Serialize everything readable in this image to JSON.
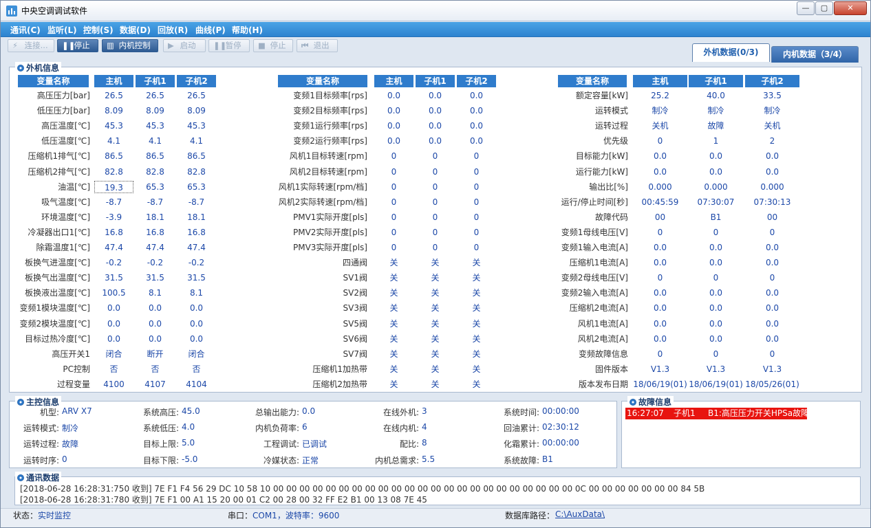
{
  "window": {
    "title": "中央空调调试软件",
    "controls": {
      "minimize": "—",
      "maximize": "▢",
      "close": "✕"
    }
  },
  "menu": [
    "通讯(C)",
    "监听(L)",
    "控制(S)",
    "数据(D)",
    "回放(R)",
    "曲线(P)",
    "帮助(H)"
  ],
  "toolbar": [
    {
      "label": "连接...",
      "icon": "connect-icon",
      "glyph": "⚡",
      "enabled": false
    },
    {
      "label": "停止",
      "icon": "pause-icon",
      "glyph": "❚❚",
      "enabled": true
    },
    {
      "label": "内机控制",
      "icon": "indoor-control-icon",
      "glyph": "▥",
      "enabled": true
    },
    {
      "label": "启动",
      "icon": "play-icon",
      "glyph": "▶",
      "enabled": false
    },
    {
      "label": "暂停",
      "icon": "pause-icon",
      "glyph": "❚❚",
      "enabled": false
    },
    {
      "label": "停止",
      "icon": "stop-icon",
      "glyph": "■",
      "enabled": false
    },
    {
      "label": "退出",
      "icon": "exit-icon",
      "glyph": "⏮",
      "enabled": false
    }
  ],
  "tabs": {
    "outdoor": "外机数据(0/3)",
    "indoor": "内机数据（3/4）"
  },
  "outdoor_panel": {
    "title": "外机信息",
    "headers": [
      "变量名称",
      "主机",
      "子机1",
      "子机2"
    ],
    "table1": [
      [
        "高压压力[bar]",
        "26.5",
        "26.5",
        "26.5"
      ],
      [
        "低压压力[bar]",
        "8.09",
        "8.09",
        "8.09"
      ],
      [
        "高压温度[℃]",
        "45.3",
        "45.3",
        "45.3"
      ],
      [
        "低压温度[℃]",
        "4.1",
        "4.1",
        "4.1"
      ],
      [
        "压缩机1排气[℃]",
        "86.5",
        "86.5",
        "86.5"
      ],
      [
        "压缩机2排气[℃]",
        "82.8",
        "82.8",
        "82.8"
      ],
      [
        "油温[℃]",
        "19.3",
        "65.3",
        "65.3"
      ],
      [
        "吸气温度[℃]",
        "-8.7",
        "-8.7",
        "-8.7"
      ],
      [
        "环境温度[℃]",
        "-3.9",
        "18.1",
        "18.1"
      ],
      [
        "冷凝器出口1[℃]",
        "16.8",
        "16.8",
        "16.8"
      ],
      [
        "除霜温度1[℃]",
        "47.4",
        "47.4",
        "47.4"
      ],
      [
        "板换气进温度[℃]",
        "-0.2",
        "-0.2",
        "-0.2"
      ],
      [
        "板换气出温度[℃]",
        "31.5",
        "31.5",
        "31.5"
      ],
      [
        "板换液出温度[℃]",
        "100.5",
        "8.1",
        "8.1"
      ],
      [
        "变频1模块温度[℃]",
        "0.0",
        "0.0",
        "0.0"
      ],
      [
        "变频2模块温度[℃]",
        "0.0",
        "0.0",
        "0.0"
      ],
      [
        "目标过热冷度[℃]",
        "0.0",
        "0.0",
        "0.0"
      ],
      [
        "高压开关1",
        "闭合",
        "断开",
        "闭合"
      ],
      [
        "PC控制",
        "否",
        "否",
        "否"
      ],
      [
        "过程变量",
        "4100",
        "4107",
        "4104"
      ]
    ],
    "table2": [
      [
        "变频1目标频率[rps]",
        "0.0",
        "0.0",
        "0.0"
      ],
      [
        "变频2目标频率[rps]",
        "0.0",
        "0.0",
        "0.0"
      ],
      [
        "变频1运行频率[rps]",
        "0.0",
        "0.0",
        "0.0"
      ],
      [
        "变频2运行频率[rps]",
        "0.0",
        "0.0",
        "0.0"
      ],
      [
        "风机1目标转速[rpm]",
        "0",
        "0",
        "0"
      ],
      [
        "风机2目标转速[rpm]",
        "0",
        "0",
        "0"
      ],
      [
        "风机1实际转速[rpm/档]",
        "0",
        "0",
        "0"
      ],
      [
        "风机2实际转速[rpm/档]",
        "0",
        "0",
        "0"
      ],
      [
        "PMV1实际开度[pls]",
        "0",
        "0",
        "0"
      ],
      [
        "PMV2实际开度[pls]",
        "0",
        "0",
        "0"
      ],
      [
        "PMV3实际开度[pls]",
        "0",
        "0",
        "0"
      ],
      [
        "四通阀",
        "关",
        "关",
        "关"
      ],
      [
        "SV1阀",
        "关",
        "关",
        "关"
      ],
      [
        "SV2阀",
        "关",
        "关",
        "关"
      ],
      [
        "SV3阀",
        "关",
        "关",
        "关"
      ],
      [
        "SV5阀",
        "关",
        "关",
        "关"
      ],
      [
        "SV6阀",
        "关",
        "关",
        "关"
      ],
      [
        "SV7阀",
        "关",
        "关",
        "关"
      ],
      [
        "压缩机1加热带",
        "关",
        "关",
        "关"
      ],
      [
        "压缩机2加热带",
        "关",
        "关",
        "关"
      ]
    ],
    "table3": [
      [
        "额定容量[kW]",
        "25.2",
        "40.0",
        "33.5"
      ],
      [
        "运转模式",
        "制冷",
        "制冷",
        "制冷"
      ],
      [
        "运转过程",
        "关机",
        "故障",
        "关机"
      ],
      [
        "优先级",
        "0",
        "1",
        "2"
      ],
      [
        "目标能力[kW]",
        "0.0",
        "0.0",
        "0.0"
      ],
      [
        "运行能力[kW]",
        "0.0",
        "0.0",
        "0.0"
      ],
      [
        "输出比[%]",
        "0.000",
        "0.000",
        "0.000"
      ],
      [
        "运行/停止时间[秒]",
        "00:45:59",
        "07:30:07",
        "07:30:13"
      ],
      [
        "故障代码",
        "00",
        "B1",
        "00"
      ],
      [
        "变频1母线电压[V]",
        "0",
        "0",
        "0"
      ],
      [
        "变频1输入电流[A]",
        "0.0",
        "0.0",
        "0.0"
      ],
      [
        "压缩机1电流[A]",
        "0.0",
        "0.0",
        "0.0"
      ],
      [
        "变频2母线电压[V]",
        "0",
        "0",
        "0"
      ],
      [
        "变频2输入电流[A]",
        "0.0",
        "0.0",
        "0.0"
      ],
      [
        "压缩机2电流[A]",
        "0.0",
        "0.0",
        "0.0"
      ],
      [
        "风机1电流[A]",
        "0.0",
        "0.0",
        "0.0"
      ],
      [
        "风机2电流[A]",
        "0.0",
        "0.0",
        "0.0"
      ],
      [
        "变频故障信息",
        "0",
        "0",
        "0"
      ],
      [
        "固件版本",
        "V1.3",
        "V1.3",
        "V1.3"
      ],
      [
        "版本发布日期",
        "18/06/19(01)",
        "18/06/19(01)",
        "18/05/26(01)"
      ]
    ]
  },
  "main_panel": {
    "title": "主控信息",
    "columns": [
      [
        [
          "机型:",
          "ARV X7"
        ],
        [
          "运转模式:",
          "制冷"
        ],
        [
          "运转过程:",
          "故障"
        ],
        [
          "运转时序:",
          "0"
        ]
      ],
      [
        [
          "系统高压:",
          "45.0"
        ],
        [
          "系统低压:",
          "4.0"
        ],
        [
          "目标上限:",
          "5.0"
        ],
        [
          "目标下限:",
          "-5.0"
        ]
      ],
      [
        [
          "总输出能力:",
          "0.0"
        ],
        [
          "内机负荷率:",
          "6"
        ],
        [
          "工程调试:",
          "已调试"
        ],
        [
          "冷媒状态:",
          "正常"
        ]
      ],
      [
        [
          "在线外机:",
          "3"
        ],
        [
          "在线内机:",
          "4"
        ],
        [
          "配比:",
          "8"
        ],
        [
          "内机总需求:",
          "5.5"
        ]
      ],
      [
        [
          "系统时间:",
          "00:00:00"
        ],
        [
          "回油累计:",
          "02:30:12"
        ],
        [
          "化霜累计:",
          "00:00:00"
        ],
        [
          "系统故障:",
          "B1"
        ]
      ]
    ]
  },
  "fault_panel": {
    "title": "故障信息",
    "rows": [
      [
        "16:27:07",
        "子机1",
        "B1:高压压力开关HPSa故障"
      ]
    ],
    "highlight_color": "#e8140f"
  },
  "comm_panel": {
    "title": "通讯数据",
    "lines": [
      "[2018-06-28 16:28:31:750 收到]  7E F1 F4 56 29 DC 10 58 10 00 00 00 00 00 00 00 00 00 00 00 00 00 00 00 00 00 00 00 00 00 00 00 0C 00 00 00 00 00 00 00 84 5B",
      "[2018-06-28 16:28:31:780 收到]  7E F1 00 A1 15 20 00 01 C2 00 28 00 32 FF E2 B1 00 13 08 7E 45"
    ]
  },
  "status": {
    "state_label": "状态：",
    "state_value": "实时监控",
    "port_label": "串口：",
    "port_value": "COM1，波特率：9600",
    "db_label": "数据库路径：",
    "db_value": "C:\\AuxData\\"
  },
  "colors": {
    "accent": "#2f7ccc",
    "value_text": "#1c48a8",
    "fault": "#e8140f"
  }
}
